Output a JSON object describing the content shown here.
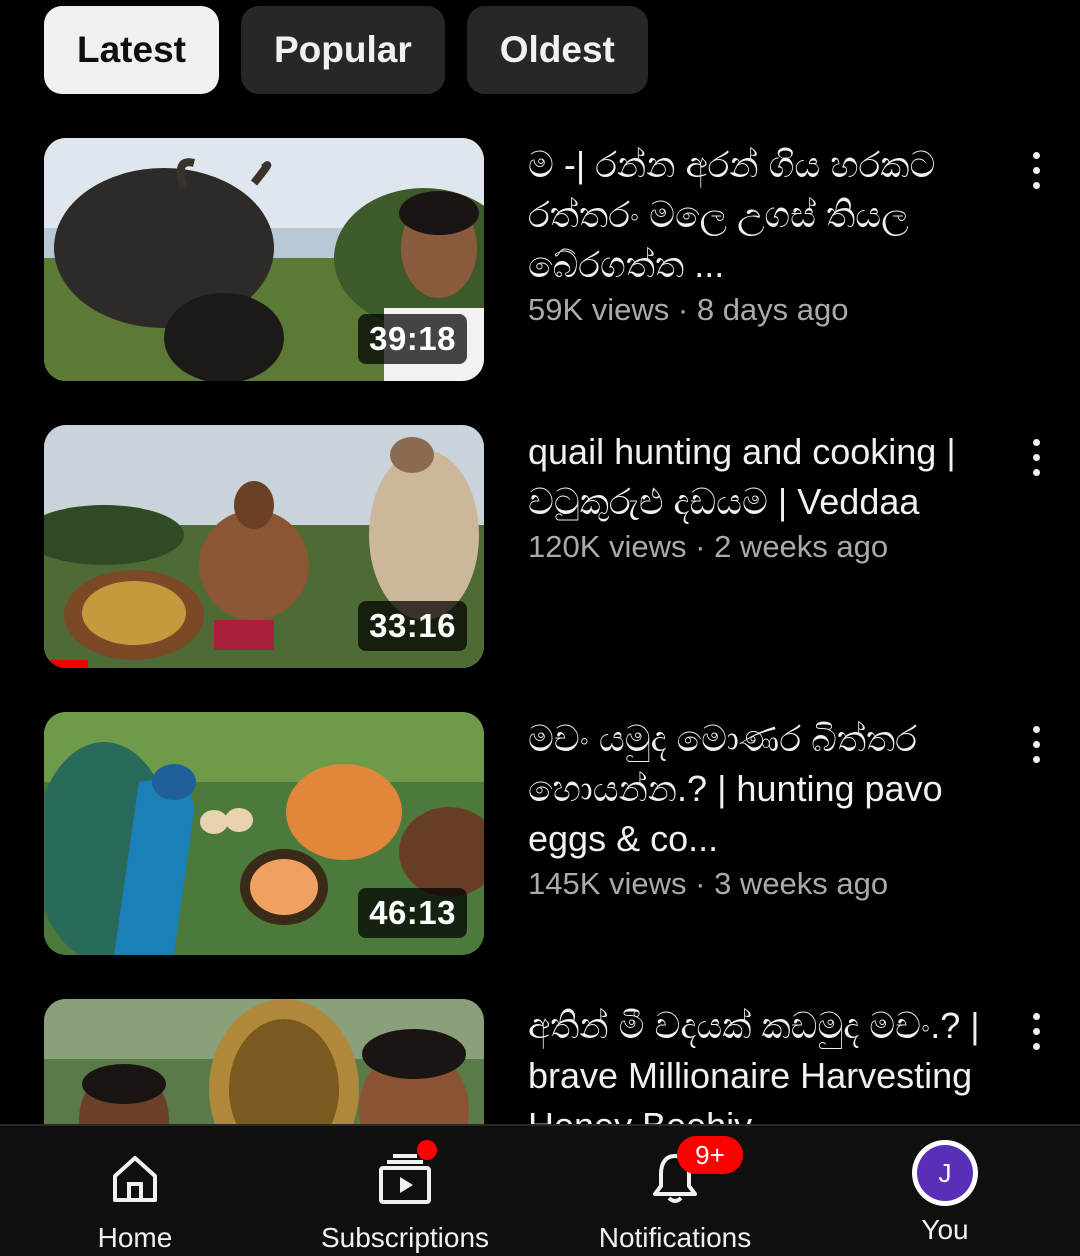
{
  "filters": {
    "chips": [
      {
        "label": "Latest",
        "active": true
      },
      {
        "label": "Popular",
        "active": false
      },
      {
        "label": "Oldest",
        "active": false
      }
    ]
  },
  "videos": [
    {
      "title": "ම -| රන්න අරන් ගිය හරකට රත්තරං මලෙ උගස් තියල බේරගත්ත ...",
      "meta": "59K views · 8 days ago",
      "duration": "39:18"
    },
    {
      "title": "quail hunting and cooking | වටුකුරුළු දඩයම | Veddaa",
      "meta": "120K views · 2 weeks ago",
      "duration": "33:16",
      "watch_progress": 0.1
    },
    {
      "title": "මචං යමුද මොණර බිත්තර හොයන්න.? | hunting pavo eggs & co...",
      "meta": "145K views · 3 weeks ago",
      "duration": "46:13"
    },
    {
      "title": "අතින් මී වදයක් කඩමුද මචං.? | brave Millionaire Harvesting Honey Beehiv",
      "meta": "",
      "duration": ""
    }
  ],
  "nav": {
    "home": {
      "label": "Home",
      "icon": "home-icon"
    },
    "subscriptions": {
      "label": "Subscriptions",
      "icon": "subscriptions-icon"
    },
    "notifications": {
      "label": "Notifications",
      "icon": "bell-icon",
      "badge": "9+"
    },
    "you": {
      "label": "You",
      "avatar_letter": "J",
      "avatar_color": "#5a2fb8"
    }
  },
  "colors": {
    "background": "#000000",
    "chip_active": "#f1f1f1",
    "chip_inactive": "#272727",
    "accent_red": "#ff0000"
  }
}
